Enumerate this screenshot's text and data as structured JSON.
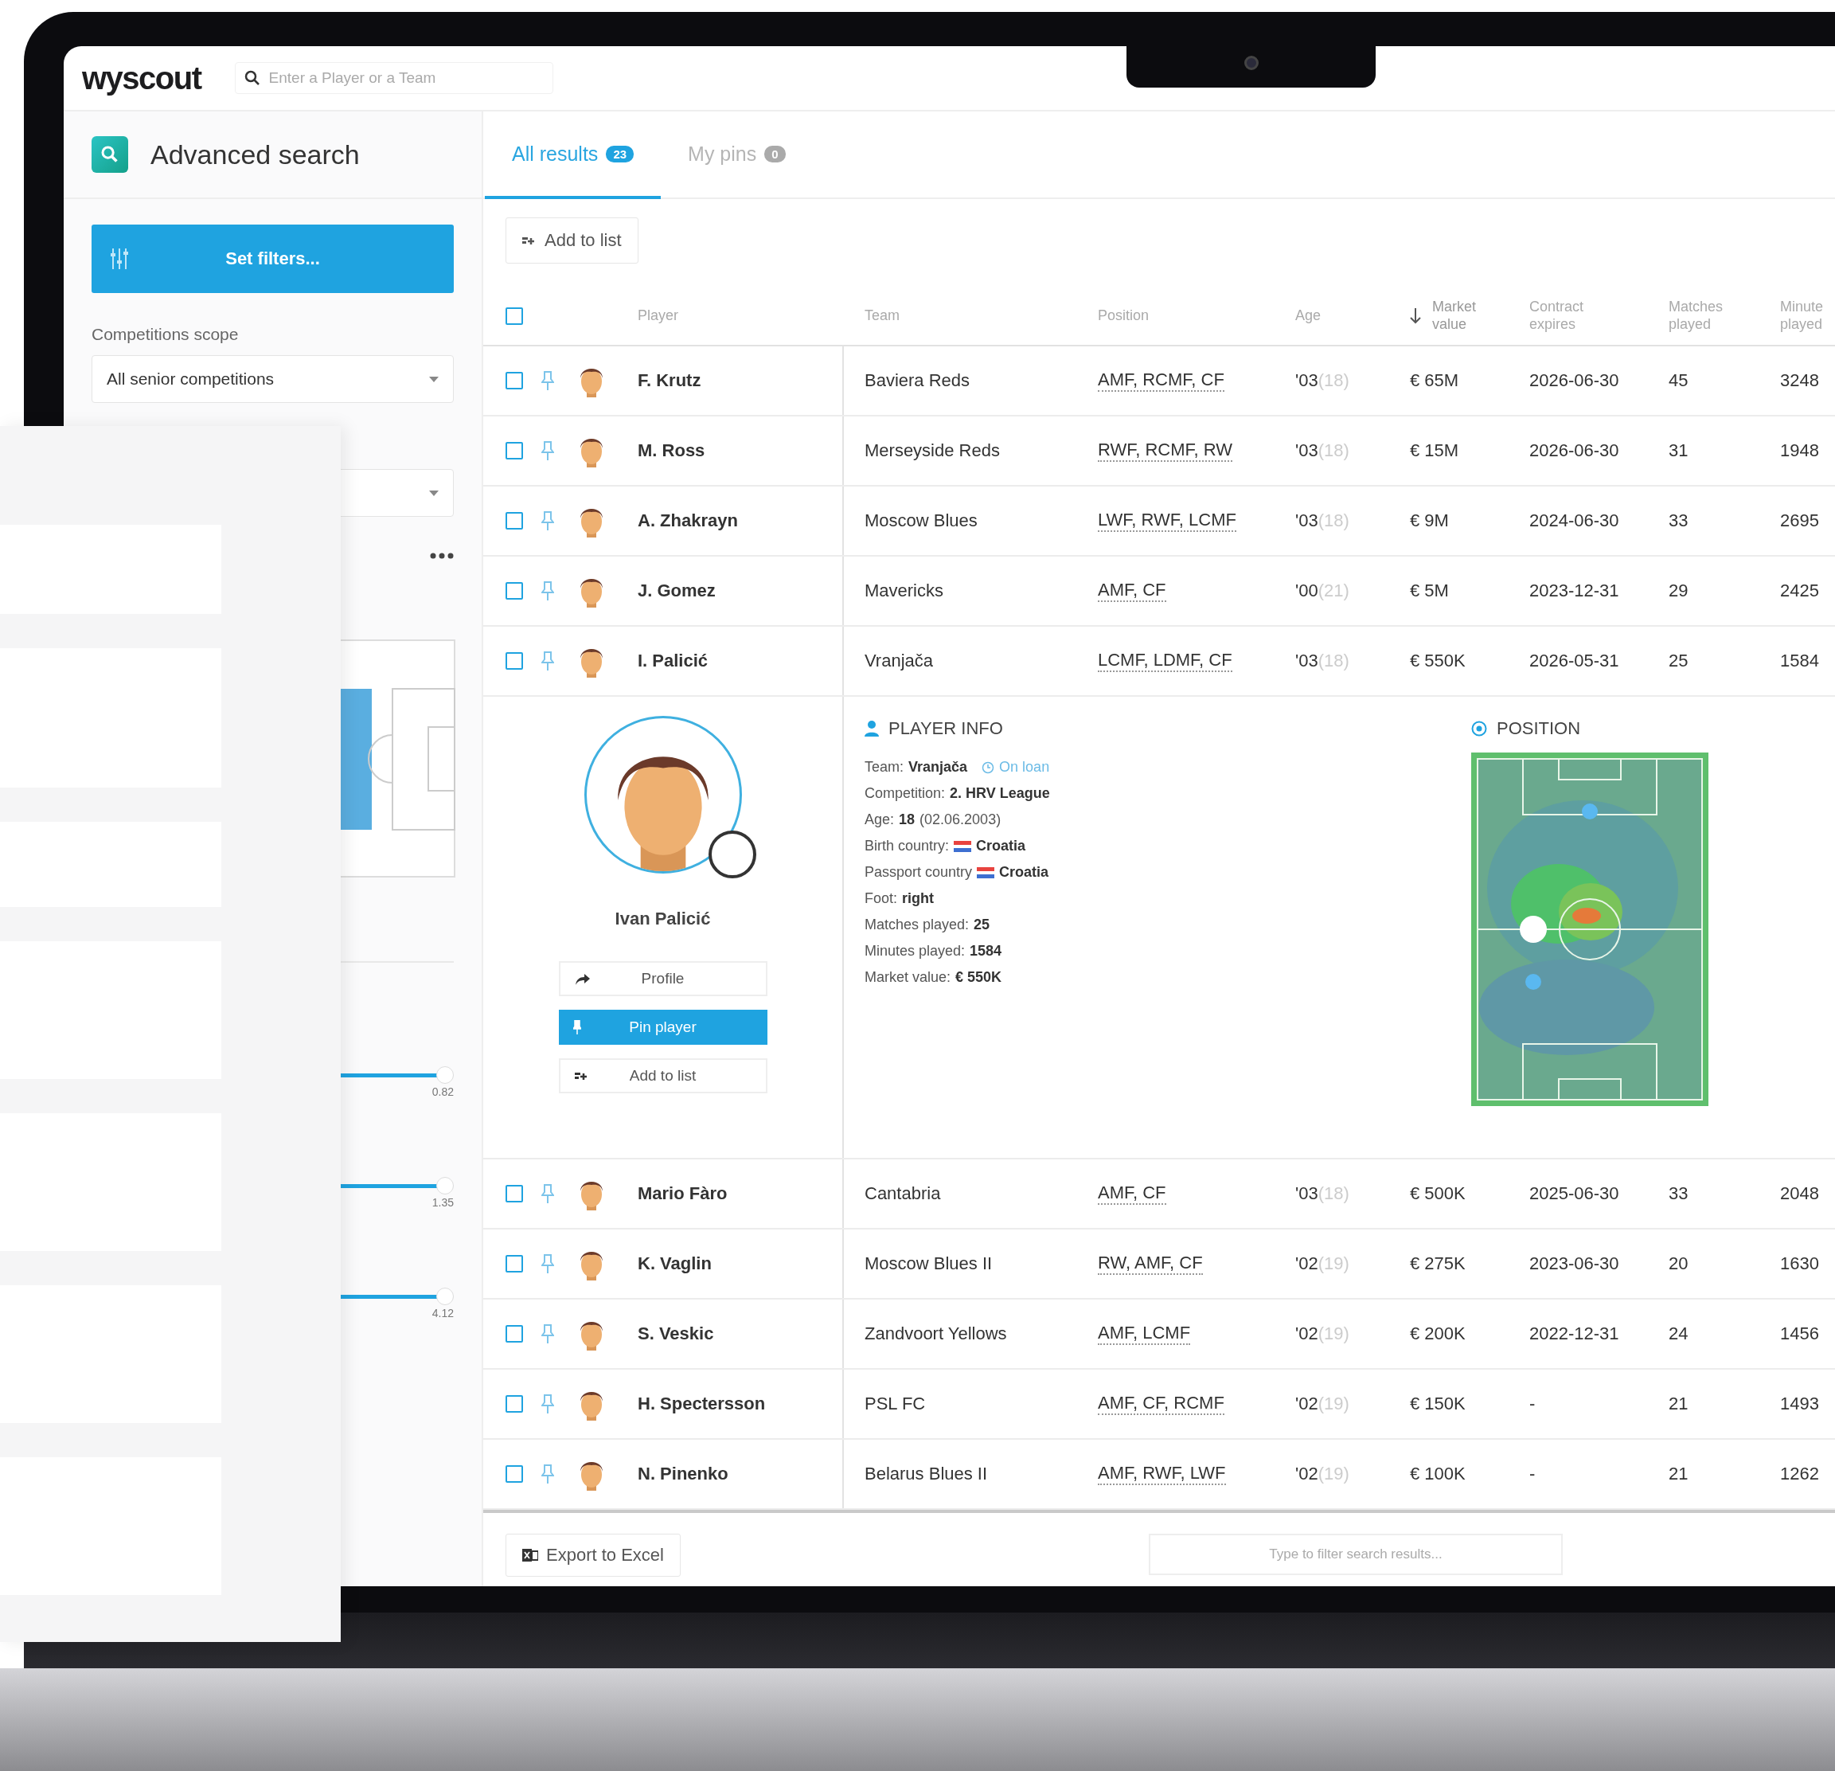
{
  "app": {
    "logo": "wyscout",
    "search_placeholder": "Enter a Player or a Team"
  },
  "sidebar": {
    "title": "Advanced search",
    "set_filters": "Set filters...",
    "scope_label": "Competitions scope",
    "scope_value": "All senior competitions",
    "sliders": [
      {
        "level": 1,
        "reading": "0.82"
      },
      {
        "level": 1,
        "reading": "1.35"
      },
      {
        "level": 1,
        "reading": "4.12"
      }
    ]
  },
  "tabs": [
    {
      "label": "All results",
      "count": "23",
      "selected": true
    },
    {
      "label": "My pins",
      "count": "0",
      "selected": false
    }
  ],
  "toolbar": {
    "add_to_list": "Add to list"
  },
  "table": {
    "select_all": {
      "checked": false
    },
    "columns": [
      {
        "label": "Player",
        "sorted": false
      },
      {
        "label": "Team",
        "sorted": false
      },
      {
        "label": "Position",
        "sorted": false
      },
      {
        "label": "Age",
        "sorted": false
      },
      {
        "label": "Market value",
        "sorted": true
      },
      {
        "label": "Contract expires",
        "sorted": false
      },
      {
        "label": "Matches played",
        "sorted": false
      },
      {
        "label": "Minute played",
        "sorted": false
      }
    ],
    "rows": [
      {
        "checked": false,
        "pinned": false,
        "player": "F. Krutz",
        "team": "Baviera Reds",
        "position": "AMF, RCMF, CF",
        "year": "'03",
        "age": "(18)",
        "market_value": "€ 65M",
        "contract": "2026-06-30",
        "matches": "45",
        "minutes": "3248"
      },
      {
        "checked": false,
        "pinned": false,
        "player": "M. Ross",
        "team": "Merseyside Reds",
        "position": "RWF, RCMF, RW",
        "year": "'03",
        "age": "(18)",
        "market_value": "€ 15M",
        "contract": "2026-06-30",
        "matches": "31",
        "minutes": "1948"
      },
      {
        "checked": false,
        "pinned": false,
        "player": "A. Zhakrayn",
        "team": "Moscow Blues",
        "position": "LWF, RWF, LCMF",
        "year": "'03",
        "age": "(18)",
        "market_value": "€ 9M",
        "contract": "2024-06-30",
        "matches": "33",
        "minutes": "2695"
      },
      {
        "checked": false,
        "pinned": false,
        "player": "J. Gomez",
        "team": "Mavericks",
        "position": "AMF, CF",
        "year": "'00",
        "age": "(21)",
        "market_value": "€ 5M",
        "contract": "2023-12-31",
        "matches": "29",
        "minutes": "2425"
      },
      {
        "checked": false,
        "pinned": false,
        "player": "I. Palicić",
        "team": "Vranjača",
        "position": "LCMF, LDMF, CF",
        "year": "'03",
        "age": "(18)",
        "market_value": "€ 550K",
        "contract": "2026-05-31",
        "matches": "25",
        "minutes": "1584",
        "detail": {
          "name": "Ivan Palicić",
          "buttons": [
            {
              "label": "Profile",
              "kind": "share",
              "primary": false
            },
            {
              "label": "Pin player",
              "kind": "pin",
              "primary": true
            },
            {
              "label": "Add to list",
              "kind": "list",
              "primary": false
            }
          ],
          "info_title": "PLAYER INFO",
          "info": [
            {
              "label": "Team:",
              "value": "Vranjača",
              "note": "On loan"
            },
            {
              "label": "Competition:",
              "value": "2. HRV League"
            },
            {
              "label": "Age:",
              "value": "18",
              "suffix": "(02.06.2003)"
            },
            {
              "label": "Birth country:",
              "flag": true,
              "value": "Croatia"
            },
            {
              "label": "Passport country",
              "flag": true,
              "value": "Croatia"
            },
            {
              "label": "Foot:",
              "value": "right"
            },
            {
              "label": "Matches played:",
              "value": "25"
            },
            {
              "label": "Minutes played:",
              "value": "1584"
            },
            {
              "label": "Market value:",
              "value": "€ 550K"
            }
          ],
          "position_title": "POSITION"
        }
      },
      {
        "checked": false,
        "pinned": false,
        "player": "Mario Fàro",
        "team": "Cantabria",
        "position": "AMF, CF",
        "year": "'03",
        "age": "(18)",
        "market_value": "€ 500K",
        "contract": "2025-06-30",
        "matches": "33",
        "minutes": "2048"
      },
      {
        "checked": false,
        "pinned": false,
        "player": "K. Vaglin",
        "team": "Moscow Blues II",
        "position": "RW, AMF, CF",
        "year": "'02",
        "age": "(19)",
        "market_value": "€ 275K",
        "contract": "2023-06-30",
        "matches": "20",
        "minutes": "1630"
      },
      {
        "checked": false,
        "pinned": false,
        "player": "S. Veskic",
        "team": "Zandvoort Yellows",
        "position": "AMF, LCMF",
        "year": "'02",
        "age": "(19)",
        "market_value": "€ 200K",
        "contract": "2022-12-31",
        "matches": "24",
        "minutes": "1456"
      },
      {
        "checked": false,
        "pinned": false,
        "player": "H. Spectersson",
        "team": "PSL FC",
        "position": "AMF, CF, RCMF",
        "year": "'02",
        "age": "(19)",
        "market_value": "€ 150K",
        "contract": "-",
        "matches": "21",
        "minutes": "1493"
      },
      {
        "checked": false,
        "pinned": false,
        "player": "N. Pinenko",
        "team": "Belarus Blues II",
        "position": "AMF, RWF, LWF",
        "year": "'02",
        "age": "(19)",
        "market_value": "€ 100K",
        "contract": "-",
        "matches": "21",
        "minutes": "1262"
      }
    ]
  },
  "footer": {
    "export": "Export to Excel",
    "filter_placeholder": "Type to filter search results..."
  }
}
